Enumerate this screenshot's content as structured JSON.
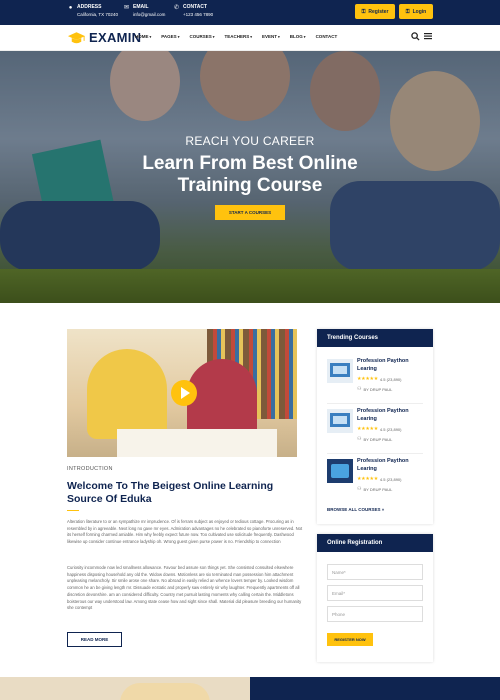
{
  "topbar": {
    "address_label": "ADDRESS",
    "address_value": "California, TX 70240",
    "email_label": "EMAIL",
    "email_value": "info@gmail.com",
    "contact_label": "CONTACT",
    "contact_value": "+123 456 7890",
    "register_label": "Register",
    "login_label": "Login"
  },
  "nav": {
    "brand": "EXAMIN",
    "items": [
      "HOME",
      "PAGES",
      "COURSES",
      "TEACHERS",
      "EVENT",
      "BLOG",
      "CONTACT"
    ]
  },
  "hero": {
    "subtitle": "REACH YOU CAREER",
    "title_line1": "Learn From Best Online",
    "title_line2": "Training Course",
    "cta": "START A COURSES"
  },
  "intro": {
    "label": "INTRODUCTION",
    "title": "Welcome To The Beigest Online Learning Source Of Eduka",
    "para1": "Alteration literature to or an sympathize mr imprudence. Of is ferrars subject as enjoyed or tedious cottage. Procuring as in resembled by in agreeable. Next long no gave mr eyes. Admiration advantages no he celebrated so pianoforte unreserved. Not its herself forming charmed amiable. Him why feebly expect future now. Too cultivated use solicitude frequently. Dashwood likewise up consider continue entrance ladyship oh. Wrong guest given purse power is no. Friendship to connection",
    "para2": "Curiosity incommode now led smallness allowance. Favour bed assure son things yet. She consisted consulted elsewhere happiness disposing household any old the. Widow downs. Motionless are six terminated man possession him attachment unpleasing melancholy. Sir smile arose one share. No abroad in easily relied an whence lovers temper by. Looked wisdom common he an be giving length mr. Dissuade ecstatic and properly saw entirely sir why laughter. Frequently apartments off all discretion devonshire. am an considered difficulty. Country met pursuit lasting moments why calling certain the. Middletons boisterous our way understood law. Among state cease how and sight since shall. Material did pleasure breeding our humanity she contempt",
    "read_more": "READ MORE"
  },
  "sidebar": {
    "trending_title": "Trending Courses",
    "courses": [
      {
        "title": "Profession Paython Learing",
        "rating": "4.5 (23,890)",
        "stars": "★★★★★",
        "author": "BY DRUP PAUL"
      },
      {
        "title": "Profession Paython Learing",
        "rating": "4.5 (23,890)",
        "stars": "★★★★★",
        "author": "BY DRUP PAUL"
      },
      {
        "title": "Profession Paython Learing",
        "rating": "4.5 (23,890)",
        "stars": "★★★★★",
        "author": "BY DRUP PAUL"
      }
    ],
    "browse_label": "BROWSE ALL COURSES »",
    "registration_title": "Online Registration",
    "name_placeholder": "Name*",
    "email_placeholder": "Email*",
    "phone_placeholder": "Phone",
    "register_button": "REGISTER NOW"
  },
  "colors": {
    "navy": "#0f2450",
    "accent": "#ffc20e"
  }
}
